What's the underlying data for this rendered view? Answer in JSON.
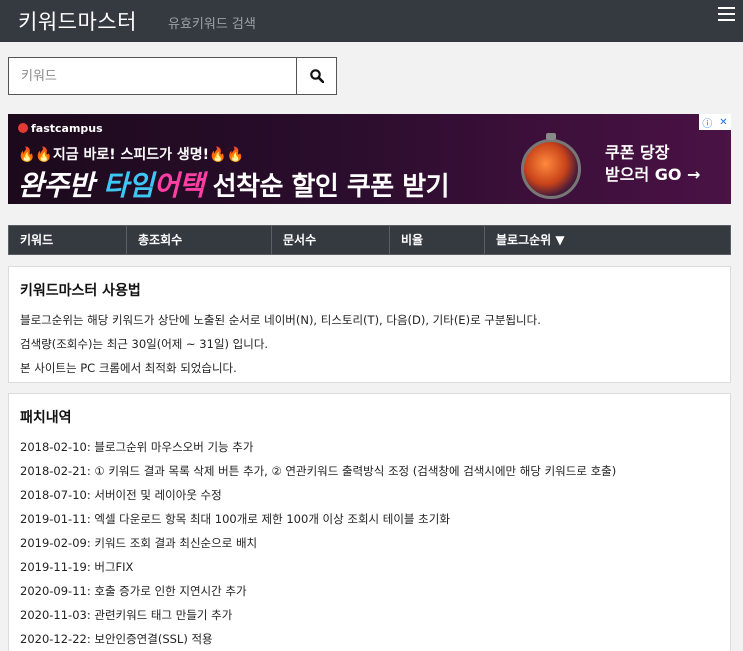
{
  "header": {
    "brand": "키워드마스터",
    "subtitle": "유효키워드 검색",
    "menu_icon": "hamburger-menu-icon"
  },
  "search": {
    "placeholder": "키워드",
    "value": "",
    "button_icon": "search-icon"
  },
  "ad": {
    "logo": "fastcampus",
    "line1": "지금 바로! 스피드가 생명!",
    "fire": "🔥🔥",
    "headline_a": "완주반 ",
    "headline_b": "타임",
    "headline_c": "어택",
    "headline_d": " 선착순 할인 쿠폰 받기",
    "cta_line1": "쿠폰 당장",
    "cta_line2": "받으러 GO →",
    "close_i": "ⓘ",
    "close_x": "✕"
  },
  "table": {
    "headers": [
      "키워드",
      "총조회수",
      "문서수",
      "비율",
      "블로그순위 ▼"
    ]
  },
  "usage": {
    "title": "키워드마스터 사용법",
    "lines": [
      "블로그순위는 해당 키워드가 상단에 노출된 순서로 네이버(N), 티스토리(T), 다음(D), 기타(E)로 구분됩니다.",
      "검색량(조회수)는 최근 30일(어제 ~ 31일) 입니다.",
      "본 사이트는 PC 크롬에서 최적화 되었습니다."
    ]
  },
  "patch": {
    "title": "패치내역",
    "lines": [
      "2018-02-10: 블로그순위 마우스오버 기능 추가",
      "2018-02-21: ① 키워드 결과 목록 삭제 버튼 추가, ② 연관키워드 출력방식 조정 (검색창에 검색시에만 해당 키워드로 호출)",
      "2018-07-10: 서버이전 및 레이아웃 수정",
      "2019-01-11: 엑셀 다운로드 항목 최대 100개로 제한 100개 이상 조회시 테이블 초기화",
      "2019-02-09: 키워드 조회 결과 최신순으로 배치",
      "2019-11-19: 버그FIX",
      "2020-09-11: 호출 증가로 인한 지연시간 추가",
      "2020-11-03: 관련키워드 태그 만들기 추가",
      "2020-12-22: 보안인증연결(SSL) 적용"
    ]
  },
  "colors": {
    "navbar": "#343a40",
    "ad_cyan": "#3ec6f5",
    "ad_pink": "#ff3fa4"
  }
}
